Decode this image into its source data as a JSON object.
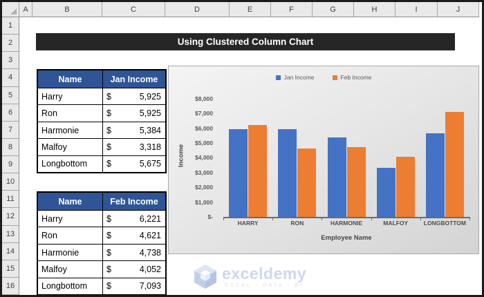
{
  "spreadsheet": {
    "column_headers": [
      "A",
      "B",
      "C",
      "D",
      "E",
      "F",
      "G",
      "H",
      "I",
      "J"
    ],
    "row_headers": [
      "1",
      "2",
      "3",
      "4",
      "5",
      "6",
      "7",
      "8",
      "9",
      "10",
      "11",
      "12",
      "13",
      "14",
      "15",
      "16"
    ]
  },
  "title_banner": {
    "text": "Using Clustered Column Chart"
  },
  "tables": [
    {
      "headers": [
        "Name",
        "Jan Income"
      ],
      "rows": [
        {
          "name": "Harry",
          "currency": "$",
          "amount": "5,925"
        },
        {
          "name": "Ron",
          "currency": "$",
          "amount": "5,925"
        },
        {
          "name": "Harmonie",
          "currency": "$",
          "amount": "5,384"
        },
        {
          "name": "Malfoy",
          "currency": "$",
          "amount": "3,318"
        },
        {
          "name": "Longbottom",
          "currency": "$",
          "amount": "5,675"
        }
      ]
    },
    {
      "headers": [
        "Name",
        "Feb Income"
      ],
      "rows": [
        {
          "name": "Harry",
          "currency": "$",
          "amount": "6,221"
        },
        {
          "name": "Ron",
          "currency": "$",
          "amount": "4,621"
        },
        {
          "name": "Harmonie",
          "currency": "$",
          "amount": "4,738"
        },
        {
          "name": "Malfoy",
          "currency": "$",
          "amount": "4,052"
        },
        {
          "name": "Longbottom",
          "currency": "$",
          "amount": "7,093"
        }
      ]
    }
  ],
  "chart_data": {
    "type": "bar",
    "title": "",
    "categories": [
      "HARRY",
      "RON",
      "HARMONIE",
      "MALFOY",
      "LONGBOTTOM"
    ],
    "series": [
      {
        "name": "Jan Income",
        "color": "#4472C4",
        "values": [
          5925,
          5925,
          5384,
          3318,
          5675
        ]
      },
      {
        "name": "Feb Income",
        "color": "#ED7D31",
        "values": [
          6221,
          4621,
          4738,
          4052,
          7093
        ]
      }
    ],
    "xlabel": "Employee Name",
    "ylabel": "Income",
    "ylim": [
      0,
      8000
    ],
    "ytick_step": 1000,
    "ytick_labels": [
      "$-",
      "$1,000",
      "$2,000",
      "$3,000",
      "$4,000",
      "$5,000",
      "$6,000",
      "$7,000",
      "$8,000"
    ],
    "legend_position": "top",
    "grid": false
  },
  "watermark": {
    "brand": "exceldemy",
    "tagline": "EXCEL - DATA - BI"
  },
  "colors": {
    "banner_bg": "#262626",
    "banner_fg": "#FFFFFF",
    "table_header_bg": "#2F5597",
    "series_jan": "#4472C4",
    "series_feb": "#ED7D31",
    "axis_text": "#595959",
    "watermark_blue": "#CCD8F0"
  }
}
